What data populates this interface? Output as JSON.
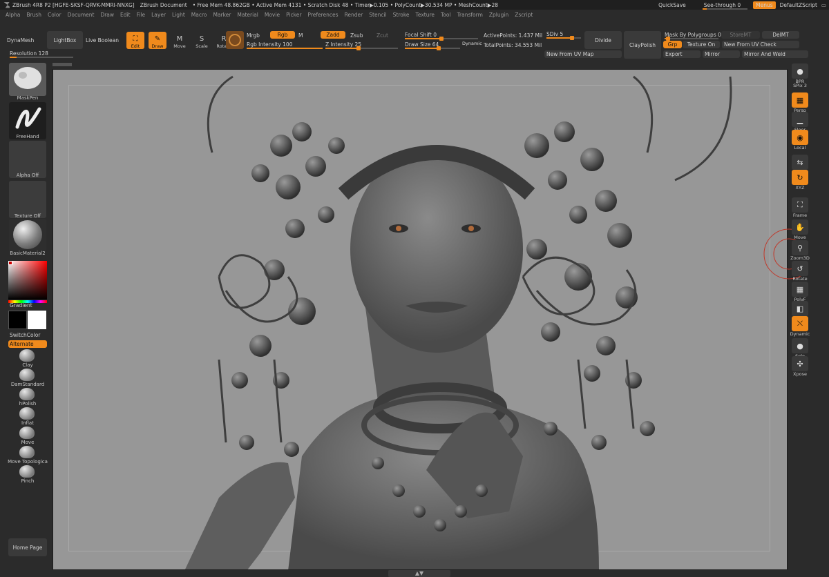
{
  "titlebar": {
    "app": "ZBrush 4R8 P2 [HGFE-SKSF-QRVK-MMRI-NNXG]",
    "doc": "ZBrush Document",
    "stats": "• Free Mem 48.862GB • Active Mem 4131 • Scratch Disk 48 • Timer▶0.105 • PolyCount▶30.534 MP • MeshCount▶28",
    "quicksave": "QuickSave",
    "seethrough": "See-through  0",
    "menus": "Menus",
    "script": "DefaultZScript"
  },
  "menubar": [
    "Alpha",
    "Brush",
    "Color",
    "Document",
    "Draw",
    "Edit",
    "File",
    "Layer",
    "Light",
    "Macro",
    "Marker",
    "Material",
    "Movie",
    "Picker",
    "Preferences",
    "Render",
    "Stencil",
    "Stroke",
    "Texture",
    "Tool",
    "Transform",
    "Zplugin",
    "Zscript"
  ],
  "shelf": {
    "dynamesh": "DynaMesh",
    "lightbox": "LightBox",
    "liveboolean": "Live Boolean",
    "resolution": "Resolution 128",
    "tools": [
      {
        "label": "Edit",
        "icon": "edit-icon",
        "glyph": "⛶",
        "on": true
      },
      {
        "label": "Draw",
        "icon": "draw-icon",
        "glyph": "✎",
        "on": true
      },
      {
        "label": "Move",
        "icon": "move-icon",
        "glyph": "M",
        "on": false
      },
      {
        "label": "Scale",
        "icon": "scale-icon",
        "glyph": "S",
        "on": false
      },
      {
        "label": "Rotate",
        "icon": "rotate-icon",
        "glyph": "R",
        "on": false
      }
    ],
    "mrgb": "Mrgb",
    "rgb": "Rgb",
    "m": "M",
    "zadd": "Zadd",
    "zsub": "Zsub",
    "zcut": "Zcut",
    "rgb_intensity": "Rgb Intensity 100",
    "z_intensity": "Z Intensity 25",
    "focal_shift": "Focal Shift 0",
    "draw_size": "Draw Size 64",
    "dynamic": "Dynamic",
    "active_points": "ActivePoints: 1.437 Mil",
    "total_points": "TotalPoints: 34.553 Mil",
    "sdiv": "SDiv 5",
    "divide": "Divide",
    "new_from_uv": "New From UV Map",
    "claypolish": "ClayPolish",
    "mask_by_polygroups": "Mask By Polygroups 0",
    "storemt": "StoreMT",
    "delmt": "DelMT",
    "grp": "Grp",
    "texture_on": "Texture On",
    "new_from_uv_check": "New From UV Check",
    "export": "Export",
    "mirror": "Mirror",
    "mirror_and_weld": "Mirror And Weld"
  },
  "left": {
    "maskpen": "MaskPen",
    "freehand": "FreeHand",
    "alpha_off": "Alpha Off",
    "texture_off": "Texture Off",
    "material": "BasicMaterial2",
    "gradient": "Gradient",
    "switchcolor": "SwitchColor",
    "alternate": "Alternate",
    "brushes": [
      "Clay",
      "DamStandard",
      "hPolish",
      "Inflat",
      "Move",
      "Move Topologica",
      "Pinch"
    ],
    "home": "Home Page"
  },
  "right": [
    {
      "label": "BPR",
      "icon": "bpr-icon",
      "glyph": "●",
      "on": false
    },
    {
      "label": "SPix 3",
      "icon": "spix-icon",
      "glyph": "",
      "on": false
    },
    {
      "label": "Persp",
      "icon": "persp-icon",
      "glyph": "▦",
      "on": true
    },
    {
      "label": "Floor",
      "icon": "floor-icon",
      "glyph": "▁",
      "on": false
    },
    {
      "label": "Local",
      "icon": "local-icon",
      "glyph": "◉",
      "on": true
    },
    {
      "label": "L.Sym",
      "icon": "lsym-icon",
      "glyph": "⇆",
      "on": false
    },
    {
      "label": "XYZ",
      "icon": "xyz-icon",
      "glyph": "↻",
      "on": true
    },
    {
      "label": "Frame",
      "icon": "frame-icon",
      "glyph": "⛶",
      "on": false
    },
    {
      "label": "Move",
      "icon": "hand-icon",
      "glyph": "✋",
      "on": false
    },
    {
      "label": "Zoom3D",
      "icon": "zoom-icon",
      "glyph": "⚲",
      "on": false
    },
    {
      "label": "Rotate",
      "icon": "rotate-icon",
      "glyph": "↺",
      "on": false
    },
    {
      "label": "PolyF",
      "icon": "polyframe-icon",
      "glyph": "▦",
      "on": false
    },
    {
      "label": "Transp",
      "icon": "transp-icon",
      "glyph": "◧",
      "on": false
    },
    {
      "label": "Dynamic",
      "icon": "ghost-icon",
      "glyph": "⛌",
      "on": true
    },
    {
      "label": "Solo",
      "icon": "solo-icon",
      "glyph": "●",
      "on": false
    },
    {
      "label": "Xpose",
      "icon": "xpose-icon",
      "glyph": "✣",
      "on": false
    }
  ],
  "colors": {
    "accent": "#f08a1c",
    "viewport": "#979797",
    "panel": "#2b2b2b"
  }
}
